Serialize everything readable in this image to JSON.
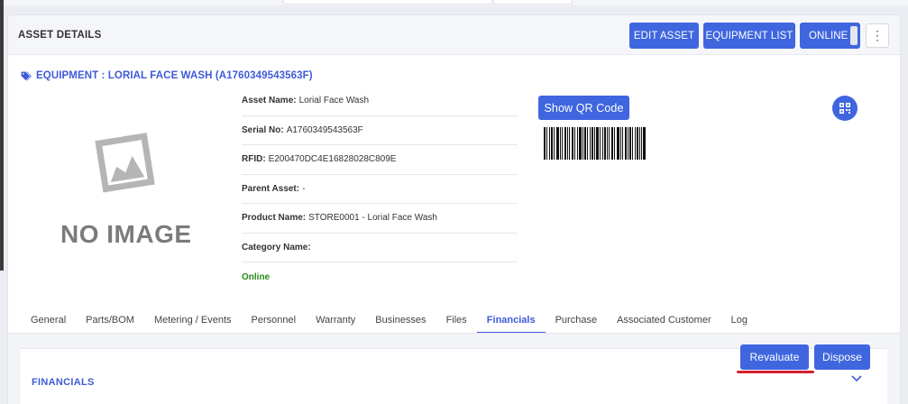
{
  "header": {
    "title": "ASSET DETAILS",
    "buttons": {
      "edit_asset": "EDIT ASSET",
      "equipment_list": "EQUIPMENT LIST",
      "online": "ONLINE",
      "more": "⋮"
    }
  },
  "equipment": {
    "heading": "EQUIPMENT : LORIAL FACE WASH (A1760349543563F)",
    "no_image_text": "NO IMAGE",
    "details": [
      {
        "label": "Asset Name:",
        "value": "Lorial Face Wash"
      },
      {
        "label": "Serial No:",
        "value": "A1760349543563F"
      },
      {
        "label": "RFID:",
        "value": "E200470DC4E16828028C809E"
      },
      {
        "label": "Parent Asset:",
        "value": "-"
      },
      {
        "label": "Product Name:",
        "value": "STORE0001 - Lorial Face Wash"
      },
      {
        "label": "Category Name:",
        "value": ""
      }
    ],
    "status": "Online",
    "show_qr_label": "Show QR Code"
  },
  "tabs": [
    {
      "label": "General",
      "active": false
    },
    {
      "label": "Parts/BOM",
      "active": false
    },
    {
      "label": "Metering / Events",
      "active": false
    },
    {
      "label": "Personnel",
      "active": false
    },
    {
      "label": "Warranty",
      "active": false
    },
    {
      "label": "Businesses",
      "active": false
    },
    {
      "label": "Files",
      "active": false
    },
    {
      "label": "Financials",
      "active": true
    },
    {
      "label": "Purchase",
      "active": false
    },
    {
      "label": "Associated Customer",
      "active": false
    },
    {
      "label": "Log",
      "active": false
    }
  ],
  "financials": {
    "revaluate_label": "Revaluate",
    "dispose_label": "Dispose",
    "section_title": "FINANCIALS"
  },
  "colors": {
    "primary": "#3f66de",
    "link": "#3f5bd8",
    "status_online": "#2a8a1c",
    "annotation_underline": "#d2202f"
  },
  "icons": [
    "tag-icon",
    "image-placeholder-icon",
    "barcode",
    "qr-code-icon",
    "chevron-down-icon",
    "more-vertical-icon"
  ]
}
